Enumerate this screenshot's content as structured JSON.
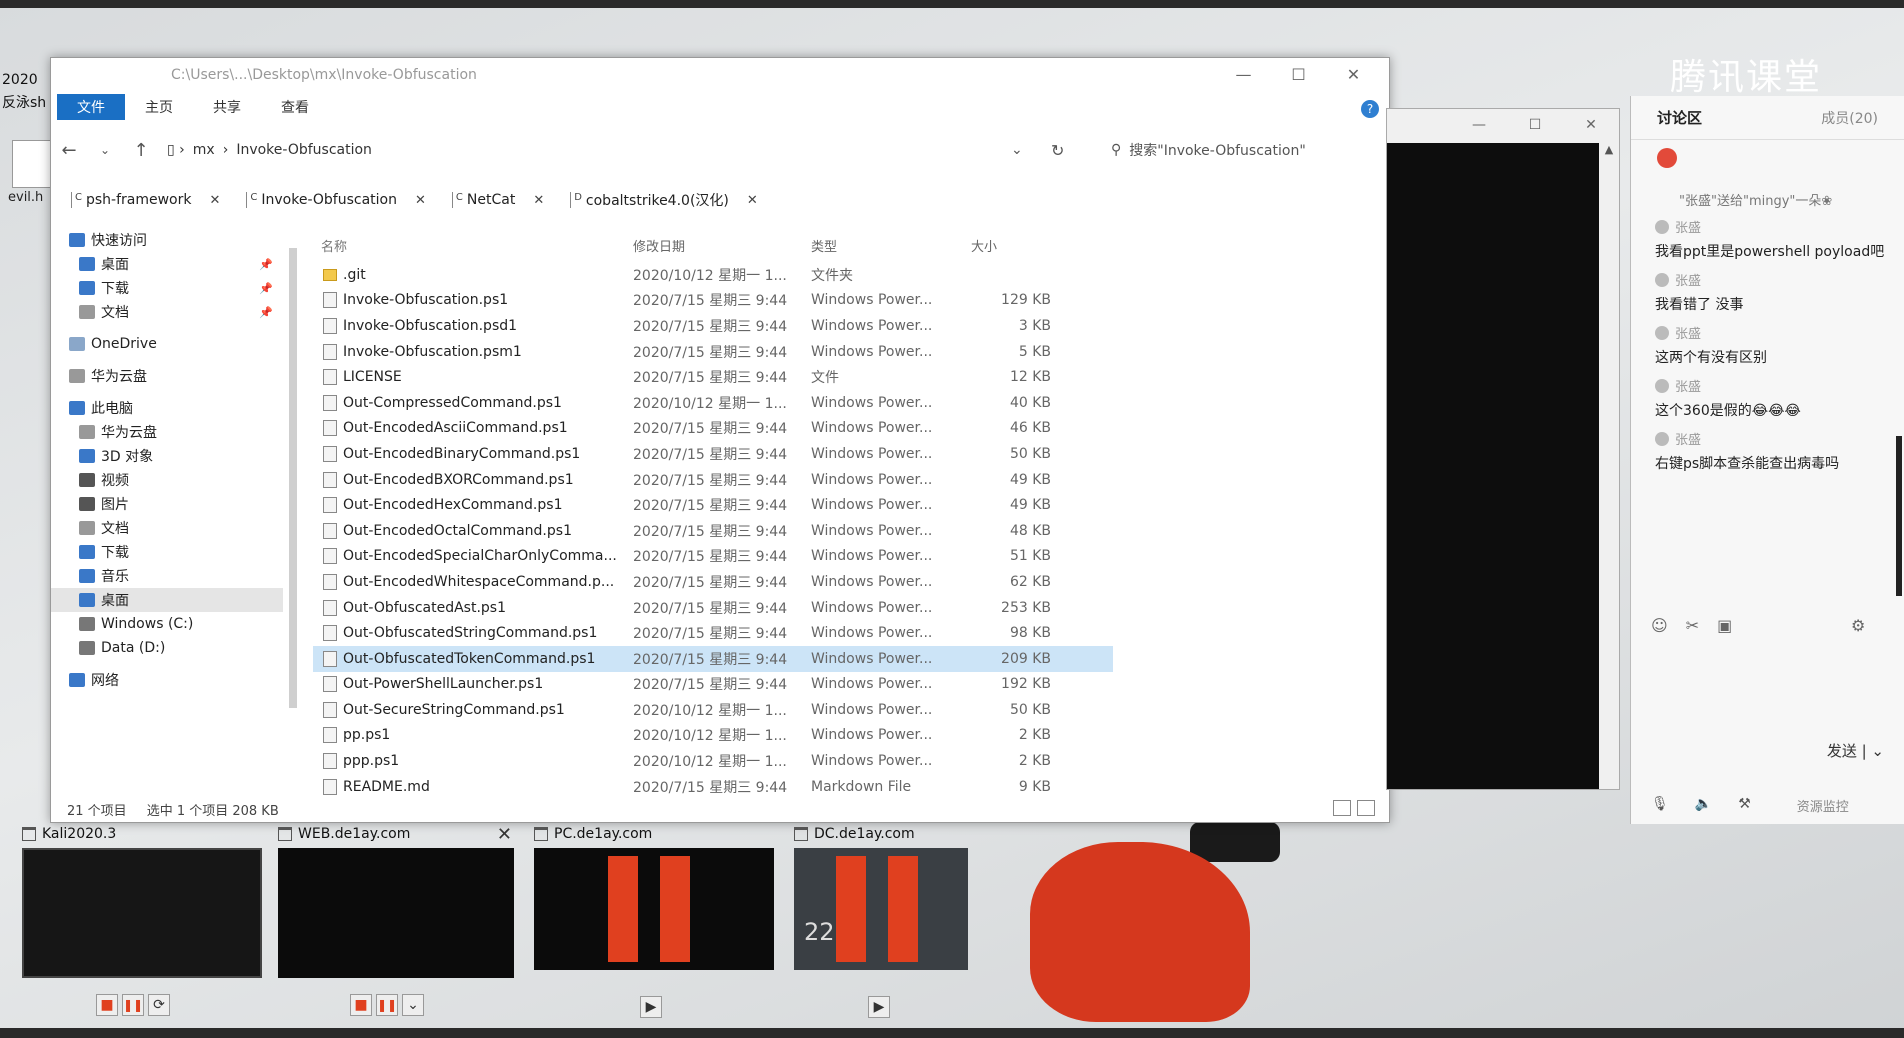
{
  "desktop": {
    "left_text_1": "2020",
    "left_text_2": "反泳sh",
    "evil_icon_label": "evil.h"
  },
  "explorer": {
    "title_path": "C:\\Users\\...\\Desktop\\mx\\Invoke-Obfuscation",
    "ribbon_tabs": [
      "文件",
      "主页",
      "共享",
      "查看"
    ],
    "breadcrumb": [
      "mx",
      "Invoke-Obfuscation"
    ],
    "search_placeholder": "搜索\"Invoke-Obfuscation\"",
    "folder_tabs": [
      {
        "label": "psh-framework"
      },
      {
        "label": "Invoke-Obfuscation"
      },
      {
        "label": "NetCat"
      },
      {
        "label": "cobaltstrike4.0(汉化)"
      }
    ],
    "nav_items": [
      {
        "label": "快速访问",
        "icon": "star-icon",
        "color": "#3a78c8",
        "indent": 0
      },
      {
        "label": "桌面",
        "icon": "desktop-icon",
        "color": "#3a78c8",
        "indent": 1,
        "pinned": true
      },
      {
        "label": "下载",
        "icon": "download-icon",
        "color": "#3a78c8",
        "indent": 1,
        "pinned": true
      },
      {
        "label": "文档",
        "icon": "document-icon",
        "color": "#999999",
        "indent": 1,
        "pinned": true
      },
      {
        "label": "OneDrive",
        "icon": "cloud-icon",
        "color": "#8aa7c9",
        "indent": 0
      },
      {
        "label": "华为云盘",
        "icon": "cloud-icon",
        "color": "#999999",
        "indent": 0
      },
      {
        "label": "此电脑",
        "icon": "computer-icon",
        "color": "#3a78c8",
        "indent": 0
      },
      {
        "label": "华为云盘",
        "icon": "cloud-icon",
        "color": "#999999",
        "indent": 1
      },
      {
        "label": "3D 对象",
        "icon": "cube-icon",
        "color": "#3a78c8",
        "indent": 1
      },
      {
        "label": "视频",
        "icon": "video-icon",
        "color": "#555555",
        "indent": 1
      },
      {
        "label": "图片",
        "icon": "picture-icon",
        "color": "#555555",
        "indent": 1
      },
      {
        "label": "文档",
        "icon": "document-icon",
        "color": "#999999",
        "indent": 1
      },
      {
        "label": "下载",
        "icon": "download-icon",
        "color": "#3a78c8",
        "indent": 1
      },
      {
        "label": "音乐",
        "icon": "music-icon",
        "color": "#3a78c8",
        "indent": 1
      },
      {
        "label": "桌面",
        "icon": "desktop-icon",
        "color": "#3a78c8",
        "indent": 1,
        "selected": true
      },
      {
        "label": "Windows (C:)",
        "icon": "drive-icon",
        "color": "#777777",
        "indent": 1
      },
      {
        "label": "Data (D:)",
        "icon": "drive-icon",
        "color": "#777777",
        "indent": 1
      },
      {
        "label": "网络",
        "icon": "network-icon",
        "color": "#3a78c8",
        "indent": 0
      }
    ],
    "columns": [
      "名称",
      "修改日期",
      "类型",
      "大小"
    ],
    "files": [
      {
        "name": ".git",
        "date": "2020/10/12 星期一 1...",
        "type": "文件夹",
        "size": "",
        "folder": true
      },
      {
        "name": "Invoke-Obfuscation.ps1",
        "date": "2020/7/15 星期三 9:44",
        "type": "Windows Power...",
        "size": "129 KB"
      },
      {
        "name": "Invoke-Obfuscation.psd1",
        "date": "2020/7/15 星期三 9:44",
        "type": "Windows Power...",
        "size": "3 KB"
      },
      {
        "name": "Invoke-Obfuscation.psm1",
        "date": "2020/7/15 星期三 9:44",
        "type": "Windows Power...",
        "size": "5 KB"
      },
      {
        "name": "LICENSE",
        "date": "2020/7/15 星期三 9:44",
        "type": "文件",
        "size": "12 KB"
      },
      {
        "name": "Out-CompressedCommand.ps1",
        "date": "2020/10/12 星期一 1...",
        "type": "Windows Power...",
        "size": "40 KB"
      },
      {
        "name": "Out-EncodedAsciiCommand.ps1",
        "date": "2020/7/15 星期三 9:44",
        "type": "Windows Power...",
        "size": "46 KB"
      },
      {
        "name": "Out-EncodedBinaryCommand.ps1",
        "date": "2020/7/15 星期三 9:44",
        "type": "Windows Power...",
        "size": "50 KB"
      },
      {
        "name": "Out-EncodedBXORCommand.ps1",
        "date": "2020/7/15 星期三 9:44",
        "type": "Windows Power...",
        "size": "49 KB"
      },
      {
        "name": "Out-EncodedHexCommand.ps1",
        "date": "2020/7/15 星期三 9:44",
        "type": "Windows Power...",
        "size": "49 KB"
      },
      {
        "name": "Out-EncodedOctalCommand.ps1",
        "date": "2020/7/15 星期三 9:44",
        "type": "Windows Power...",
        "size": "48 KB"
      },
      {
        "name": "Out-EncodedSpecialCharOnlyComma...",
        "date": "2020/7/15 星期三 9:44",
        "type": "Windows Power...",
        "size": "51 KB"
      },
      {
        "name": "Out-EncodedWhitespaceCommand.p...",
        "date": "2020/7/15 星期三 9:44",
        "type": "Windows Power...",
        "size": "62 KB"
      },
      {
        "name": "Out-ObfuscatedAst.ps1",
        "date": "2020/7/15 星期三 9:44",
        "type": "Windows Power...",
        "size": "253 KB"
      },
      {
        "name": "Out-ObfuscatedStringCommand.ps1",
        "date": "2020/7/15 星期三 9:44",
        "type": "Windows Power...",
        "size": "98 KB"
      },
      {
        "name": "Out-ObfuscatedTokenCommand.ps1",
        "date": "2020/7/15 星期三 9:44",
        "type": "Windows Power...",
        "size": "209 KB",
        "selected": true
      },
      {
        "name": "Out-PowerShellLauncher.ps1",
        "date": "2020/7/15 星期三 9:44",
        "type": "Windows Power...",
        "size": "192 KB"
      },
      {
        "name": "Out-SecureStringCommand.ps1",
        "date": "2020/10/12 星期一 1...",
        "type": "Windows Power...",
        "size": "50 KB"
      },
      {
        "name": "pp.ps1",
        "date": "2020/10/12 星期一 1...",
        "type": "Windows Power...",
        "size": "2 KB"
      },
      {
        "name": "ppp.ps1",
        "date": "2020/10/12 星期一 1...",
        "type": "Windows Power...",
        "size": "2 KB"
      },
      {
        "name": "README.md",
        "date": "2020/7/15 星期三 9:44",
        "type": "Markdown File",
        "size": "9 KB"
      }
    ],
    "status": {
      "count": "21 个项目",
      "selected": "选中 1 个项目  208 KB"
    }
  },
  "chat": {
    "brand": "腾讯课堂",
    "tab_discussion": "讨论区",
    "tab_members": "成员(20)",
    "gift_message": "\"张盛\"送给\"mingy\"一朵❀",
    "messages": [
      {
        "name": "张盛",
        "text": "我看ppt里是powershell poyload吧"
      },
      {
        "name": "张盛",
        "text": "我看错了 没事"
      },
      {
        "name": "张盛",
        "text": "这两个有没有区别"
      },
      {
        "name": "张盛",
        "text": "这个360是假的😂😂😂"
      },
      {
        "name": "张盛",
        "text": "右键ps脚本查杀能查出病毒吗"
      }
    ],
    "send_label": "发送",
    "resource_label": "资源监控"
  },
  "vms": [
    {
      "name": "Kali2020.3",
      "state": "running"
    },
    {
      "name": "WEB.de1ay.com",
      "state": "running"
    },
    {
      "name": "PC.de1ay.com",
      "state": "paused"
    },
    {
      "name": "DC.de1ay.com",
      "state": "paused",
      "clock": "22"
    }
  ],
  "colors": {
    "accent": "#1a6fc4",
    "selection": "#cce4f7",
    "pause_red": "#e0401f"
  }
}
